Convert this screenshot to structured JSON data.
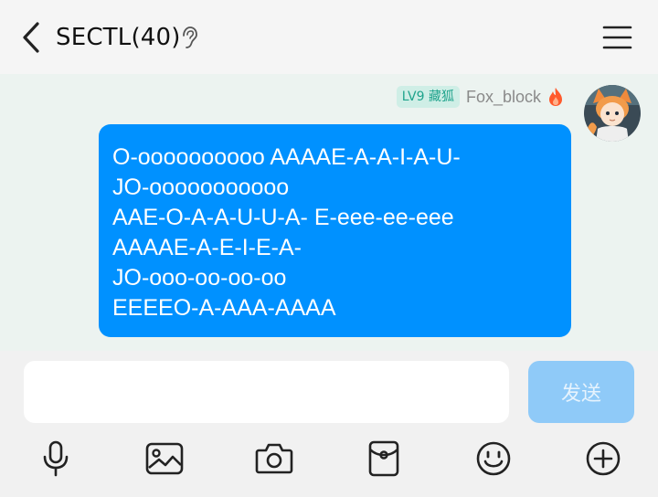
{
  "header": {
    "title": "SECTL(40)",
    "back_icon": "chevron-left-icon",
    "status_icon": "ear-icon",
    "menu_icon": "hamburger-menu-icon"
  },
  "message": {
    "level_badge": "LV9 藏狐",
    "sender_name": "Fox_block",
    "sender_icon": "flame-icon",
    "text": "O-oooooooooo AAAAE-A-A-I-A-U-\nJO-ooooooooooo\nAAE-O-A-A-U-U-A- E-eee-ee-eee\nAAAAE-A-E-I-E-A-\nJO-ooo-oo-oo-oo\nEEEEO-A-AAA-AAAA",
    "bubble_color": "#0091ff"
  },
  "composer": {
    "input_value": "",
    "send_label": "发送"
  },
  "toolbar": {
    "icons": [
      "microphone-icon",
      "image-icon",
      "camera-icon",
      "red-packet-icon",
      "emoji-icon",
      "plus-circle-icon"
    ]
  }
}
